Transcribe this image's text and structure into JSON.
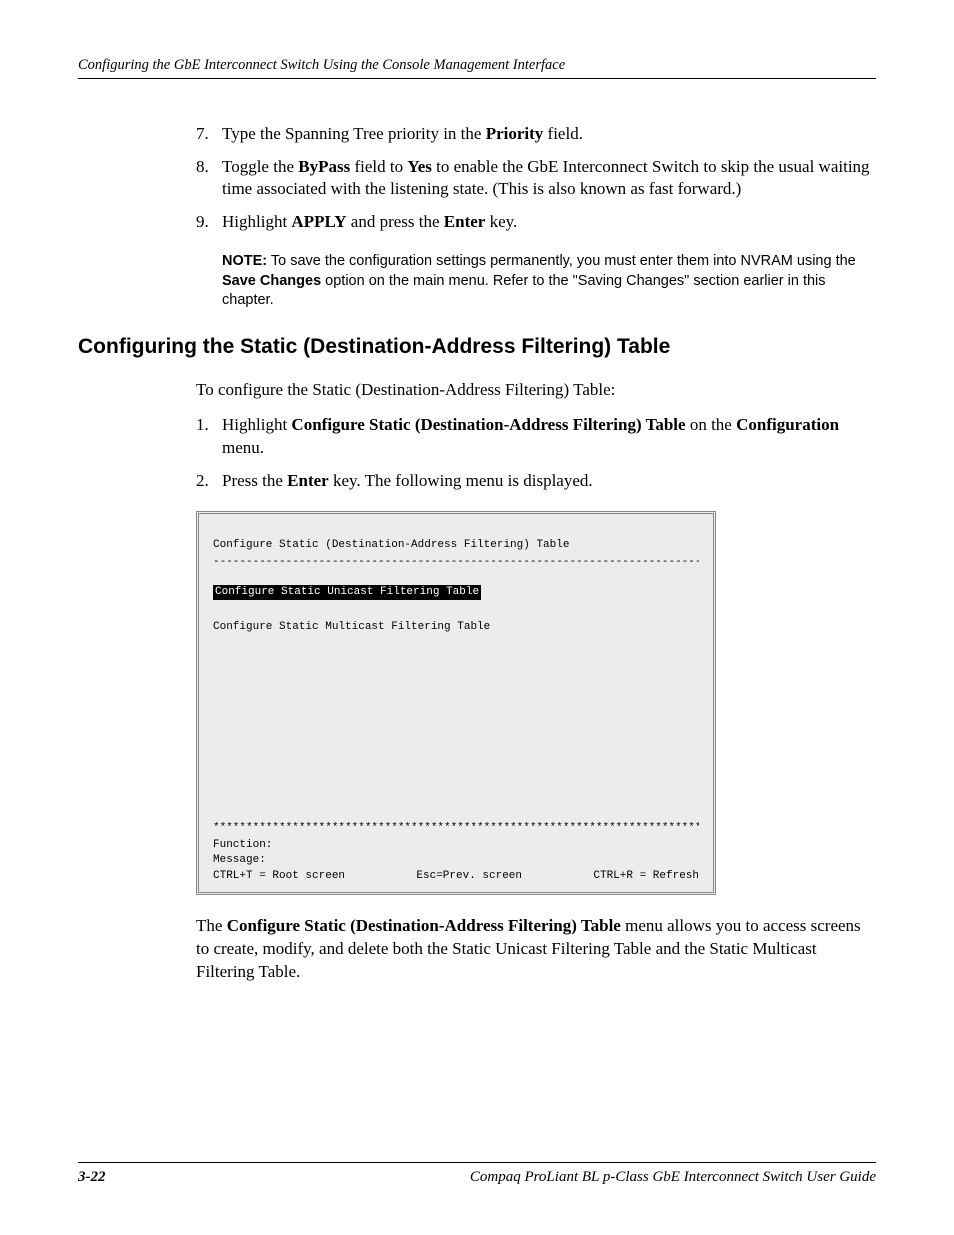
{
  "header": {
    "running_head": "Configuring the GbE Interconnect Switch Using the Console Management Interface"
  },
  "steps1": [
    {
      "num": "7.",
      "pre": "Type the Spanning Tree priority in the ",
      "b1": "Priority",
      "post": " field."
    },
    {
      "num": "8.",
      "pre": "Toggle the ",
      "b1": "ByPass",
      "mid1": " field to ",
      "b2": "Yes",
      "post": "  to enable the GbE Interconnect Switch to skip the usual waiting time associated with the listening state. (This is also known as fast forward.)"
    },
    {
      "num": "9.",
      "pre": "Highlight ",
      "b1": "APPLY",
      "mid1": " and press the ",
      "b2": "Enter",
      "post": " key."
    }
  ],
  "note": {
    "label": "NOTE:",
    "text_pre": "  To save the configuration settings permanently, you must enter them into NVRAM using the ",
    "bold": "Save Changes",
    "text_post": " option on the main menu. Refer to the \"Saving Changes\" section earlier in this chapter."
  },
  "section_title": "Configuring the Static (Destination-Address Filtering) Table",
  "intro": "To configure the Static (Destination-Address Filtering) Table:",
  "steps2": [
    {
      "num": "1.",
      "pre": "Highlight ",
      "b1": "Configure Static (Destination-Address Filtering) Table",
      "mid1": " on the ",
      "b2": "Configuration",
      "post": " menu."
    },
    {
      "num": "2.",
      "pre": "Press the ",
      "b1": "Enter",
      "post": " key. The following menu is displayed."
    }
  ],
  "terminal": {
    "title": "Configure Static (Destination-Address Filtering) Table",
    "dashes": "--------------------------------------------------------------------------------",
    "item1": "Configure Static Unicast Filtering Table",
    "item2": "Configure Static Multicast Filtering Table",
    "stars": "********************************************************************************",
    "function_label": "Function:",
    "message_label": "Message:",
    "foot_left": "CTRL+T = Root screen",
    "foot_mid": "Esc=Prev. screen",
    "foot_right": "CTRL+R = Refresh"
  },
  "closing": {
    "pre": "The ",
    "bold": "Configure Static (Destination-Address Filtering) Table",
    "post": " menu allows you to access screens to create, modify, and delete both the Static Unicast Filtering Table and the Static Multicast Filtering Table."
  },
  "footer": {
    "page": "3-22",
    "doc": "Compaq ProLiant BL p-Class GbE Interconnect Switch User Guide"
  }
}
